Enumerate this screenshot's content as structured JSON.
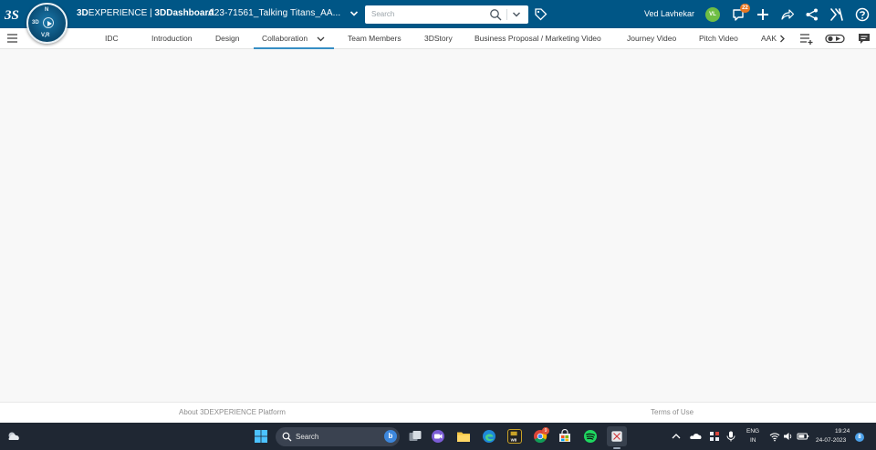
{
  "header": {
    "brand_prefix": "3D",
    "brand_main": "EXPERIENCE",
    "brand_separator": " | ",
    "brand_app_prefix": "3D",
    "brand_app": "Dashboard",
    "dashboard_title": "A23-71561_Talking Titans_AA...",
    "search_placeholder": "Search",
    "user_name": "Ved Lavhekar",
    "user_initials": "VL",
    "notification_count": "22",
    "compass": {
      "n": "N",
      "we": "3D",
      "v": "V,R"
    },
    "colors": {
      "bar": "#005686",
      "avatar": "#6fbe44",
      "badge": "#e87722"
    }
  },
  "tabs": [
    {
      "label": "IDC"
    },
    {
      "label": "Introduction"
    },
    {
      "label": "Design"
    },
    {
      "label": "Collaboration",
      "active": true
    },
    {
      "label": "Team Members"
    },
    {
      "label": "3DStory"
    },
    {
      "label": "Business Proposal / Marketing Video"
    },
    {
      "label": "Journey Video"
    },
    {
      "label": "Pitch Video"
    },
    {
      "label": "AAK"
    }
  ],
  "footer": {
    "about": "About 3DEXPERIENCE Platform",
    "terms": "Terms of Use"
  },
  "taskbar": {
    "search_label": "Search",
    "lang_top": "ENG",
    "lang_bottom": "IN",
    "time": "19:24",
    "date": "24-07-2023",
    "notification_count": "8",
    "chrome_badge": "9",
    "app_icons": [
      "windows-start-icon",
      "task-view-icon",
      "teams-chat-icon",
      "file-explorer-icon",
      "edge-icon",
      "winrar-icon",
      "chrome-icon",
      "microsoft-store-icon",
      "spotify-icon",
      "snipping-tool-icon"
    ]
  }
}
